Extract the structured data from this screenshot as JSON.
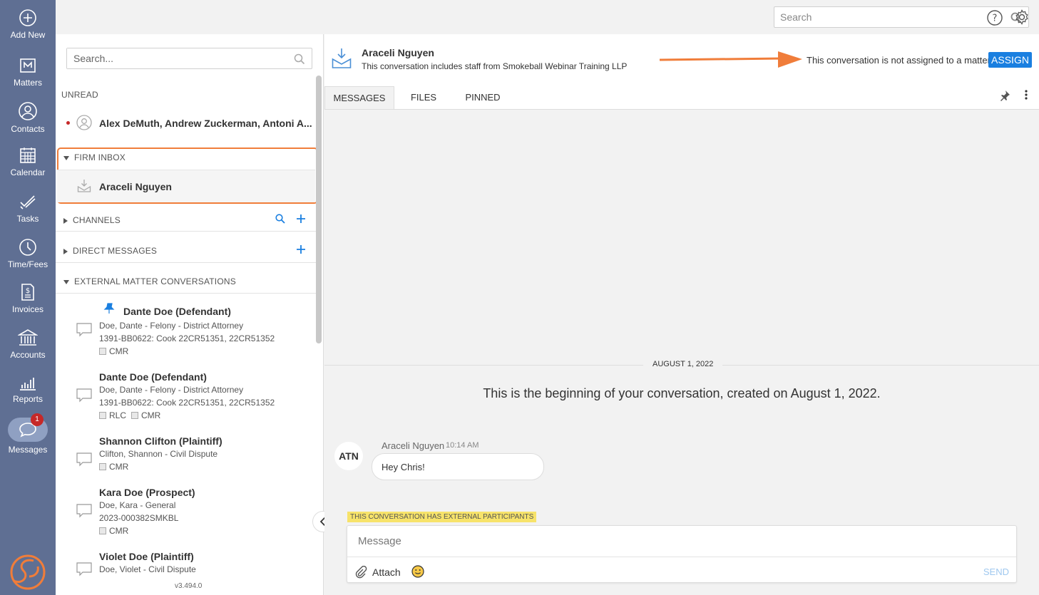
{
  "nav": {
    "items": [
      {
        "label": "Add New",
        "icon": "plus-circle-icon"
      },
      {
        "label": "Matters",
        "icon": "matters-icon"
      },
      {
        "label": "Contacts",
        "icon": "contacts-icon"
      },
      {
        "label": "Calendar",
        "icon": "calendar-icon"
      },
      {
        "label": "Tasks",
        "icon": "tasks-icon"
      },
      {
        "label": "Time/Fees",
        "icon": "clock-icon"
      },
      {
        "label": "Invoices",
        "icon": "invoice-icon"
      },
      {
        "label": "Accounts",
        "icon": "bank-icon"
      },
      {
        "label": "Reports",
        "icon": "bar-chart-icon"
      },
      {
        "label": "Messages",
        "icon": "message-icon",
        "badge": "1"
      }
    ]
  },
  "topbar": {
    "search_placeholder": "Search"
  },
  "list": {
    "search_placeholder": "Search...",
    "unread_header": "UNREAD",
    "unread_item": "Alex DeMuth, Andrew Zuckerman, Antoni A...",
    "firm_inbox_header": "FIRM INBOX",
    "firm_inbox_item": "Araceli Nguyen",
    "channels_header": "CHANNELS",
    "direct_header": "DIRECT MESSAGES",
    "external_header": "EXTERNAL MATTER CONVERSATIONS",
    "conversations": [
      {
        "name": "Dante Doe (Defendant)",
        "line1": "Doe, Dante - Felony - District Attorney",
        "line2": "1391-BB0622: Cook 22CR51351, 22CR51352",
        "tags": [
          "CMR"
        ],
        "pinned": true
      },
      {
        "name": "Dante Doe (Defendant)",
        "line1": "Doe, Dante - Felony - District Attorney",
        "line2": "1391-BB0622: Cook 22CR51351, 22CR51352",
        "tags": [
          "RLC",
          "CMR"
        ]
      },
      {
        "name": "Shannon Clifton (Plaintiff)",
        "line1": "Clifton, Shannon - Civil Dispute",
        "tags": [
          "CMR"
        ]
      },
      {
        "name": "Kara Doe (Prospect)",
        "line1": "Doe, Kara - General",
        "line2": "2023-000382SMKBL",
        "tags": [
          "CMR"
        ]
      },
      {
        "name": "Violet Doe (Plaintiff)",
        "line1": "Doe, Violet - Civil Dispute"
      }
    ],
    "version": "v3.494.0"
  },
  "conversation": {
    "title": "Araceli Nguyen",
    "subtitle": "This conversation includes staff from Smokeball Webinar Training LLP",
    "assign_text": "This conversation is not assigned to a matter",
    "assign_label": "ASSIGN",
    "tabs": [
      "MESSAGES",
      "FILES",
      "PINNED"
    ],
    "date_label": "AUGUST 1, 2022",
    "beginning_text": "This is the beginning of your conversation, created on August 1, 2022.",
    "message": {
      "avatar": "ATN",
      "author": "Araceli Nguyen",
      "time": "10:14 AM",
      "text": "Hey Chris!"
    },
    "external_badge": "THIS CONVERSATION HAS EXTERNAL PARTICIPANTS",
    "composer_placeholder": "Message",
    "attach_label": "Attach",
    "send_label": "SEND"
  },
  "colors": {
    "nav_bg": "#5f6f93",
    "accent": "#1a7fe0",
    "highlight": "#f07d3a",
    "badge": "#c62828"
  }
}
